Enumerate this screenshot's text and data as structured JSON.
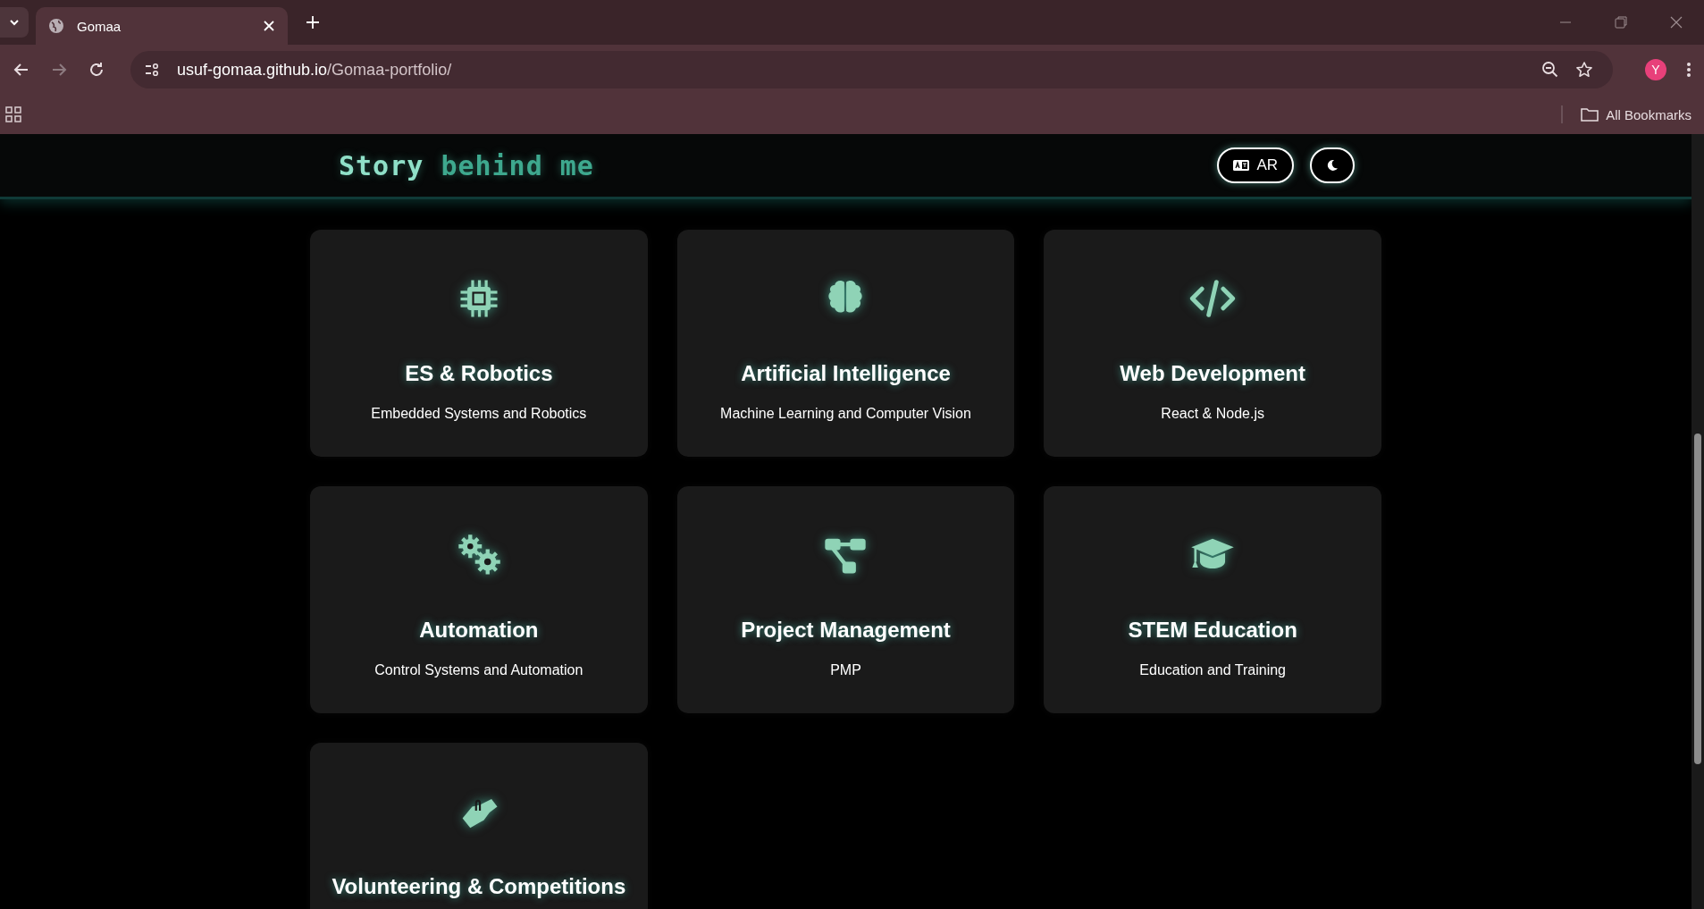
{
  "browser": {
    "tab": {
      "title": "Gomaa",
      "selected": true
    },
    "url_host": "usuf-gomaa.github.io",
    "url_path": "/Gomaa-portfolio/",
    "profile": "Y",
    "bookmarks": "All Bookmarks"
  },
  "header": {
    "title_start": "Story",
    "title_end": "behind me",
    "buttons": [
      {
        "kind": "language",
        "label": "AR"
      },
      {
        "kind": "theme"
      }
    ]
  },
  "cards": [
    {
      "title": "ES & Robotics",
      "description": "Embedded Systems and Robotics"
    },
    {
      "title": "Artificial Intelligence",
      "description": "Machine Learning and Computer Vision"
    },
    {
      "title": "Web Development",
      "description": "React & Node.js"
    },
    {
      "title": "Automation",
      "description": "Control Systems and Automation"
    },
    {
      "title": "Project Management",
      "description": "PMP"
    },
    {
      "title": "STEM Education",
      "description": "Education and Training"
    },
    {
      "title": "Volunteering & Competitions"
    }
  ]
}
